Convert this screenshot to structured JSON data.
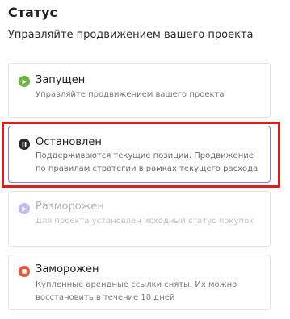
{
  "header": {
    "title": "Статус",
    "subtitle": "Управляйте продвижением вашего проекта"
  },
  "options": [
    {
      "name": "Запущен",
      "description": "Управляйте продвижением вашего проекта",
      "icon": "play-icon",
      "color": "#6cb33f",
      "state": "available"
    },
    {
      "name": "Остановлен",
      "description": "Поддерживаются текущие позиции. Продвижение по правилам стратегии в рамках текущего расхода",
      "icon": "pause-icon",
      "color": "#2a2a2a",
      "state": "selected"
    },
    {
      "name": "Разморожен",
      "description": "Для проекта установлен исходный статус покупок",
      "icon": "play-icon",
      "color": "#c7b8f0",
      "state": "disabled"
    },
    {
      "name": "Заморожен",
      "description": "Купленные арендные ссылки сняты. Их можно восстановить в течение 10 дней",
      "icon": "stop-icon",
      "color": "#e4593e",
      "state": "available"
    }
  ],
  "colors": {
    "selected_border": "#8a7bd0",
    "highlight_outline": "#d6201c"
  }
}
